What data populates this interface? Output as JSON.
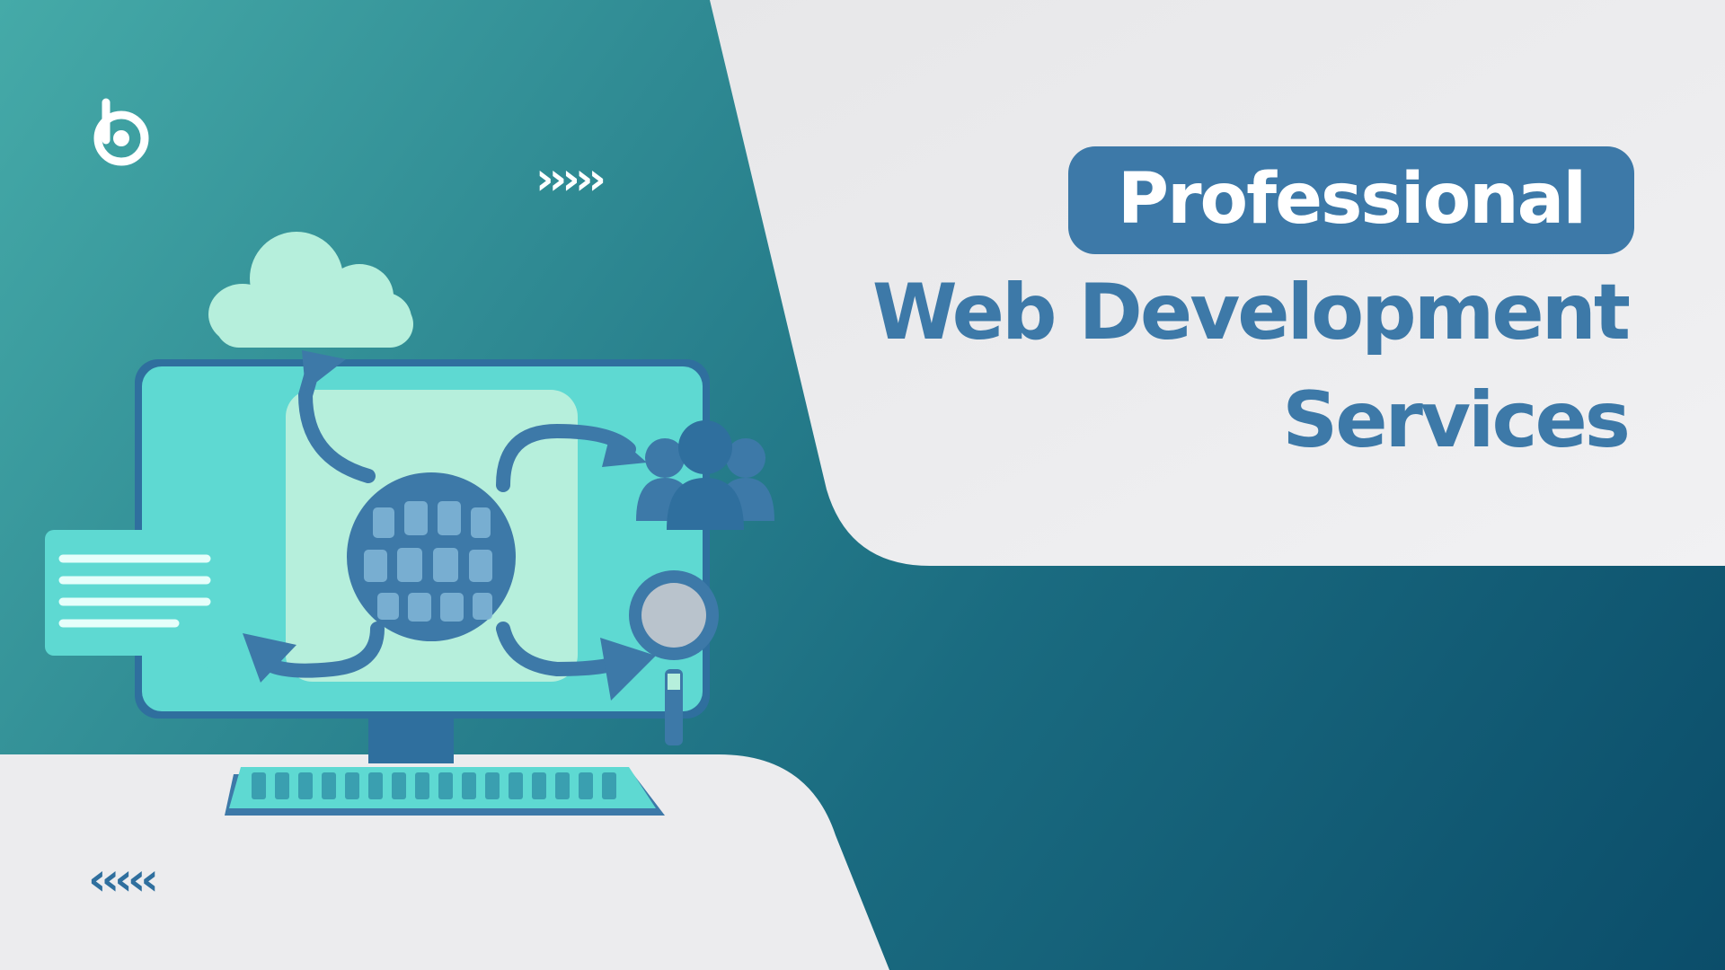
{
  "heading": {
    "badge": "Professional",
    "line2": "Web Development",
    "line3": "Services"
  },
  "decor": {
    "chevrons_right": "›››››",
    "chevrons_left": "‹‹‹‹‹"
  },
  "icons": [
    "brand-logo-icon",
    "cloud-icon",
    "globe-icon",
    "users-icon",
    "magnifier-icon",
    "chat-bubble-icon",
    "monitor-icon",
    "keyboard-icon"
  ],
  "colors": {
    "accent": "#3d79a8",
    "teal": "#2f8a93",
    "light": "#eeeeef",
    "mint": "#5ed9d2"
  }
}
